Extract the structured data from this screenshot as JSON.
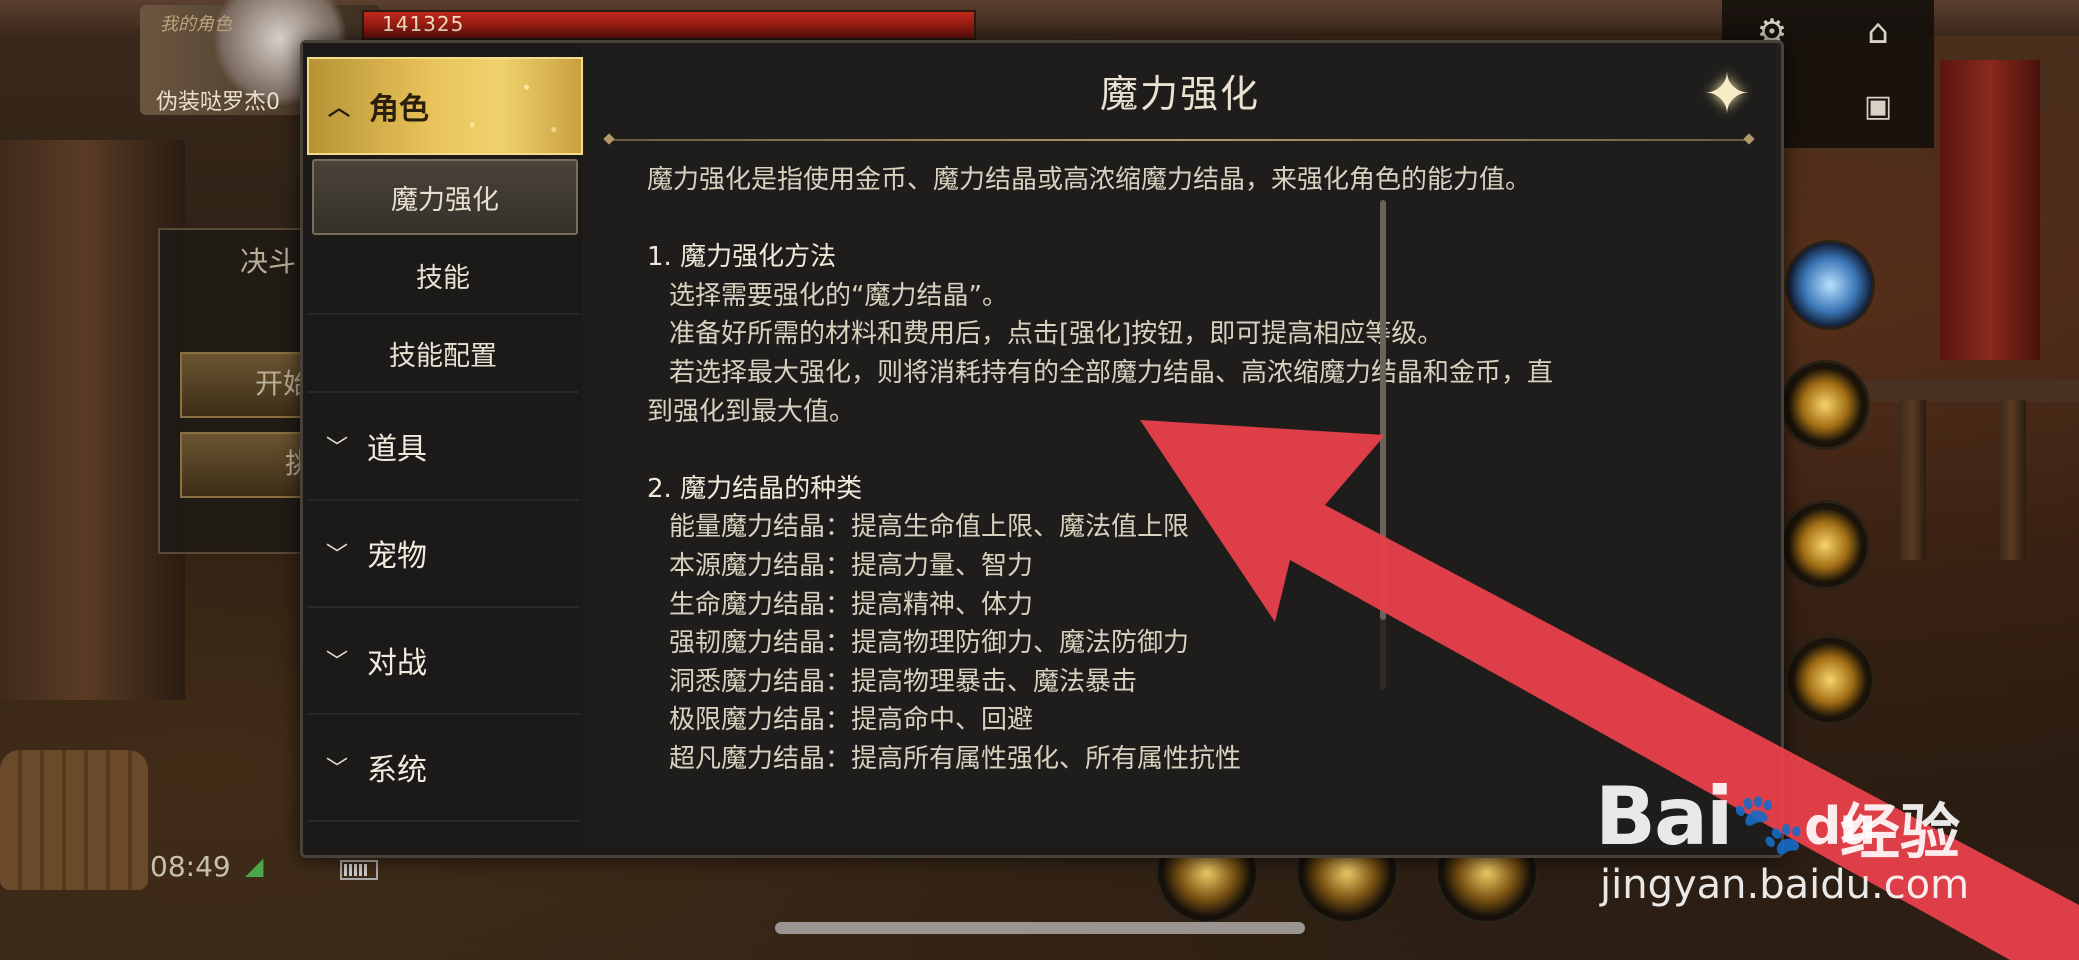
{
  "hud": {
    "role_tag": "我的角色",
    "player_name": "伪装哒罗杰0",
    "hp_value": "141325"
  },
  "top_icons": [
    "gear-icon",
    "home-icon",
    "toolbox-icon"
  ],
  "background_left": {
    "panel_text": "决斗",
    "btn1_text": "开始",
    "btn2_text": "挑"
  },
  "status_bar": {
    "time": "08:49"
  },
  "dialog": {
    "title": "魔力强化",
    "close_icon": "sparkle-close-icon",
    "sidebar": {
      "categories": [
        {
          "label": "角色",
          "expanded": true
        },
        {
          "label": "道具",
          "expanded": false
        },
        {
          "label": "宠物",
          "expanded": false
        },
        {
          "label": "对战",
          "expanded": false
        },
        {
          "label": "系统",
          "expanded": false
        }
      ],
      "sub_items": [
        "魔力强化",
        "技能",
        "技能配置"
      ],
      "selected_sub": "魔力强化"
    },
    "content": {
      "intro": "魔力强化是指使用金币、魔力结晶或高浓缩魔力结晶，来强化角色的能力值。",
      "section1_heading": "1. 魔力强化方法",
      "section1_lines": [
        "选择需要强化的“魔力结晶”。",
        "准备好所需的材料和费用后，点击[强化]按钮，即可提高相应等级。",
        "若选择最大强化，则将消耗持有的全部魔力结晶、高浓缩魔力结晶和金币，直"
      ],
      "section1_wrap": "到强化到最大值。",
      "section2_heading": "2. 魔力结晶的种类",
      "section2_lines": [
        "能量魔力结晶：提高生命值上限、魔法值上限",
        "本源魔力结晶：提高力量、智力",
        "生命魔力结晶：提高精神、体力",
        "强韧魔力结晶：提高物理防御力、魔法防御力",
        "洞悉魔力结晶：提高物理暴击、魔法暴击",
        "极限魔力结晶：提高命中、回避",
        "超凡魔力结晶：提高所有属性强化、所有属性抗性"
      ]
    }
  },
  "watermark": {
    "logo": "Bai",
    "logo_paw": "du",
    "cn": "经验",
    "url": "jingyan.baidu.com"
  },
  "colors": {
    "accent_gold": "#e8c35a",
    "arrow_red": "#e8404a",
    "panel_bg": "#1f1d1b"
  }
}
